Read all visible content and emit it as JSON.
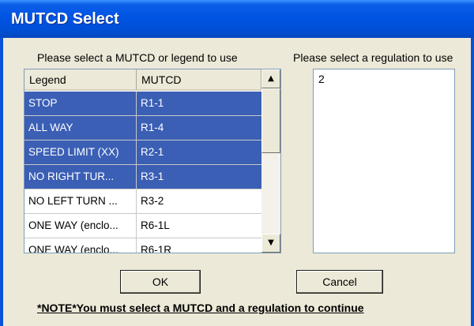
{
  "window": {
    "title": "MUTCD Select"
  },
  "mutcd_list": {
    "label": "Please select a MUTCD or legend to use",
    "columns": [
      "Legend",
      "MUTCD"
    ],
    "rows": [
      {
        "legend": "STOP",
        "mutcd": "R1-1",
        "selected": true
      },
      {
        "legend": "ALL WAY",
        "mutcd": "R1-4",
        "selected": true
      },
      {
        "legend": "SPEED LIMIT (XX)",
        "mutcd": "R2-1",
        "selected": true
      },
      {
        "legend": "NO RIGHT TUR...",
        "mutcd": "R3-1",
        "selected": true
      },
      {
        "legend": "NO LEFT TURN ...",
        "mutcd": "R3-2",
        "selected": false
      },
      {
        "legend": "ONE WAY (enclo...",
        "mutcd": "R6-1L",
        "selected": false
      },
      {
        "legend": "ONE WAY (enclo...",
        "mutcd": "R6-1R",
        "selected": false
      }
    ],
    "scroll_up_icon": "scroll-up-arrow",
    "scroll_down_icon": "scroll-down-arrow"
  },
  "regulation_list": {
    "label": "Please select a regulation to use",
    "items": [
      "2"
    ]
  },
  "buttons": {
    "ok": "OK",
    "cancel": "Cancel"
  },
  "note": "*NOTE*You must select a MUTCD and a regulation to continue",
  "colors": {
    "titlebar": "#0054e3",
    "selection": "#3b5fb5",
    "dialog_bg": "#ece9d8"
  }
}
